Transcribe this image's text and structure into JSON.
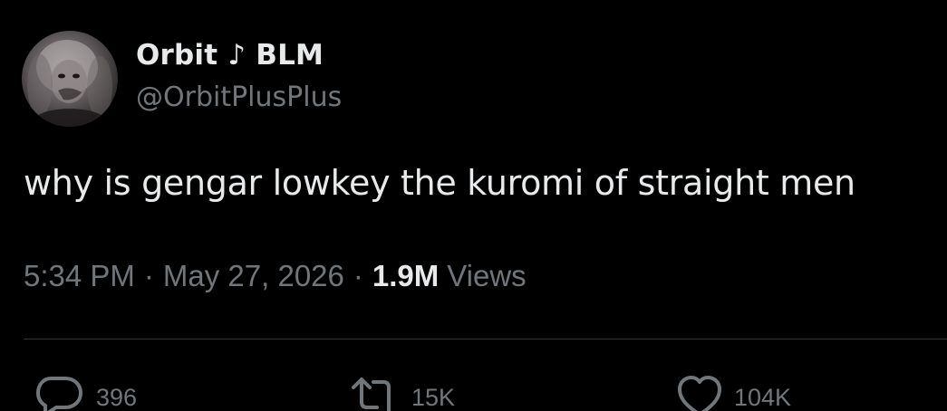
{
  "author": {
    "display_name": "Orbit ♪ BLM",
    "handle": "@OrbitPlusPlus"
  },
  "tweet": {
    "text": "why is gengar lowkey the kuromi of straight men"
  },
  "meta": {
    "time": "5:34 PM",
    "separator": "·",
    "date": "May 27, 2026",
    "views_count": "1.9M",
    "views_label": "Views"
  },
  "actions": {
    "reply_count": "396",
    "retweet_count": "15K",
    "like_count": "104K"
  },
  "icons": {
    "reply": "reply-icon",
    "retweet": "retweet-icon",
    "like": "heart-icon"
  },
  "colors": {
    "background": "#000000",
    "primary_text": "#e7e9ea",
    "secondary_text": "#71767b",
    "divider": "#2f3336"
  }
}
